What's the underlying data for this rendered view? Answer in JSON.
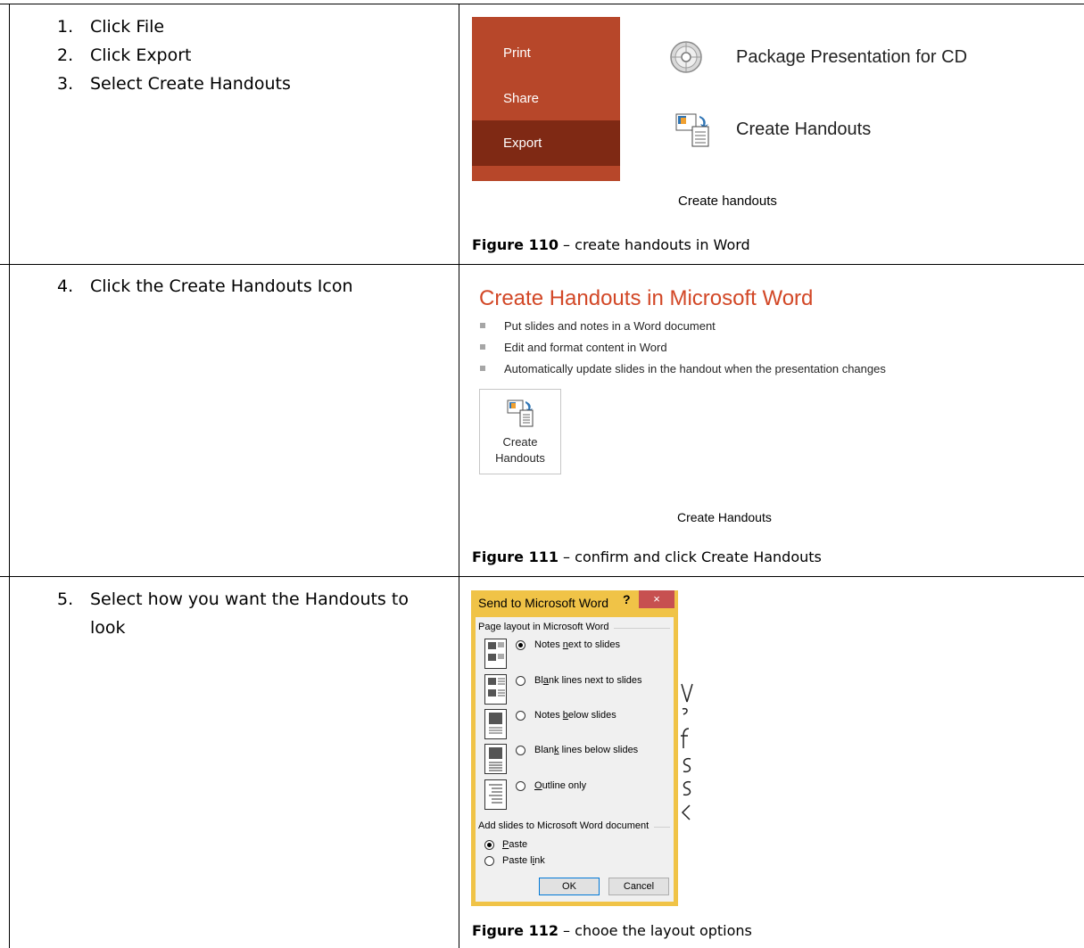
{
  "rows": [
    {
      "steps": [
        {
          "num": "1.",
          "text": "Click File"
        },
        {
          "num": "2.",
          "text": "Click Export"
        },
        {
          "num": "3.",
          "text": "Select Create Handouts"
        }
      ],
      "backstage": {
        "items": [
          "Print",
          "Share",
          "Export"
        ],
        "selected": "Export",
        "color": "#b7472a",
        "selected_color": "#7f2914"
      },
      "export_options": [
        "Package Presentation for CD",
        "Create Handouts"
      ],
      "sub_caption": "Create handouts",
      "figure_label": "Figure 110",
      "figure_text": " – create handouts in Word"
    },
    {
      "steps": [
        {
          "num": "4.",
          "text": "Click the Create Handouts Icon"
        }
      ],
      "panel_title": "Create Handouts in Microsoft Word",
      "bullets": [
        "Put slides and notes in a Word document",
        "Edit and format content in Word",
        "Automatically update slides in the handout when the presentation changes"
      ],
      "button_label_1": "Create",
      "button_label_2": "Handouts",
      "sub_caption": "Create Handouts",
      "figure_label": "Figure 111",
      "figure_text": " – confirm and click Create Handouts"
    },
    {
      "steps": [
        {
          "num": "5.",
          "text": "Select how you want the Handouts to look"
        }
      ],
      "dialog": {
        "title": "Send to Microsoft Word",
        "help": "?",
        "close": "×",
        "group1": "Page layout in Microsoft Word",
        "layout_options": [
          {
            "pre": "Notes ",
            "key": "n",
            "post": "ext to slides",
            "selected": true
          },
          {
            "pre": "Bl",
            "key": "a",
            "post": "nk lines next to slides",
            "selected": false
          },
          {
            "pre": "Notes ",
            "key": "b",
            "post": "elow slides",
            "selected": false
          },
          {
            "pre": "Blan",
            "key": "k",
            "post": " lines below slides",
            "selected": false
          },
          {
            "pre": "",
            "key": "O",
            "post": "utline only",
            "selected": false
          }
        ],
        "group2": "Add slides to Microsoft Word document",
        "paste_options": [
          {
            "pre": "",
            "key": "P",
            "post": "aste",
            "selected": true
          },
          {
            "pre": "Paste l",
            "key": "i",
            "post": "nk",
            "selected": false
          }
        ],
        "ok": "OK",
        "cancel": "Cancel"
      },
      "figure_label": "Figure 112",
      "figure_text": " – chooe the layout options"
    }
  ]
}
